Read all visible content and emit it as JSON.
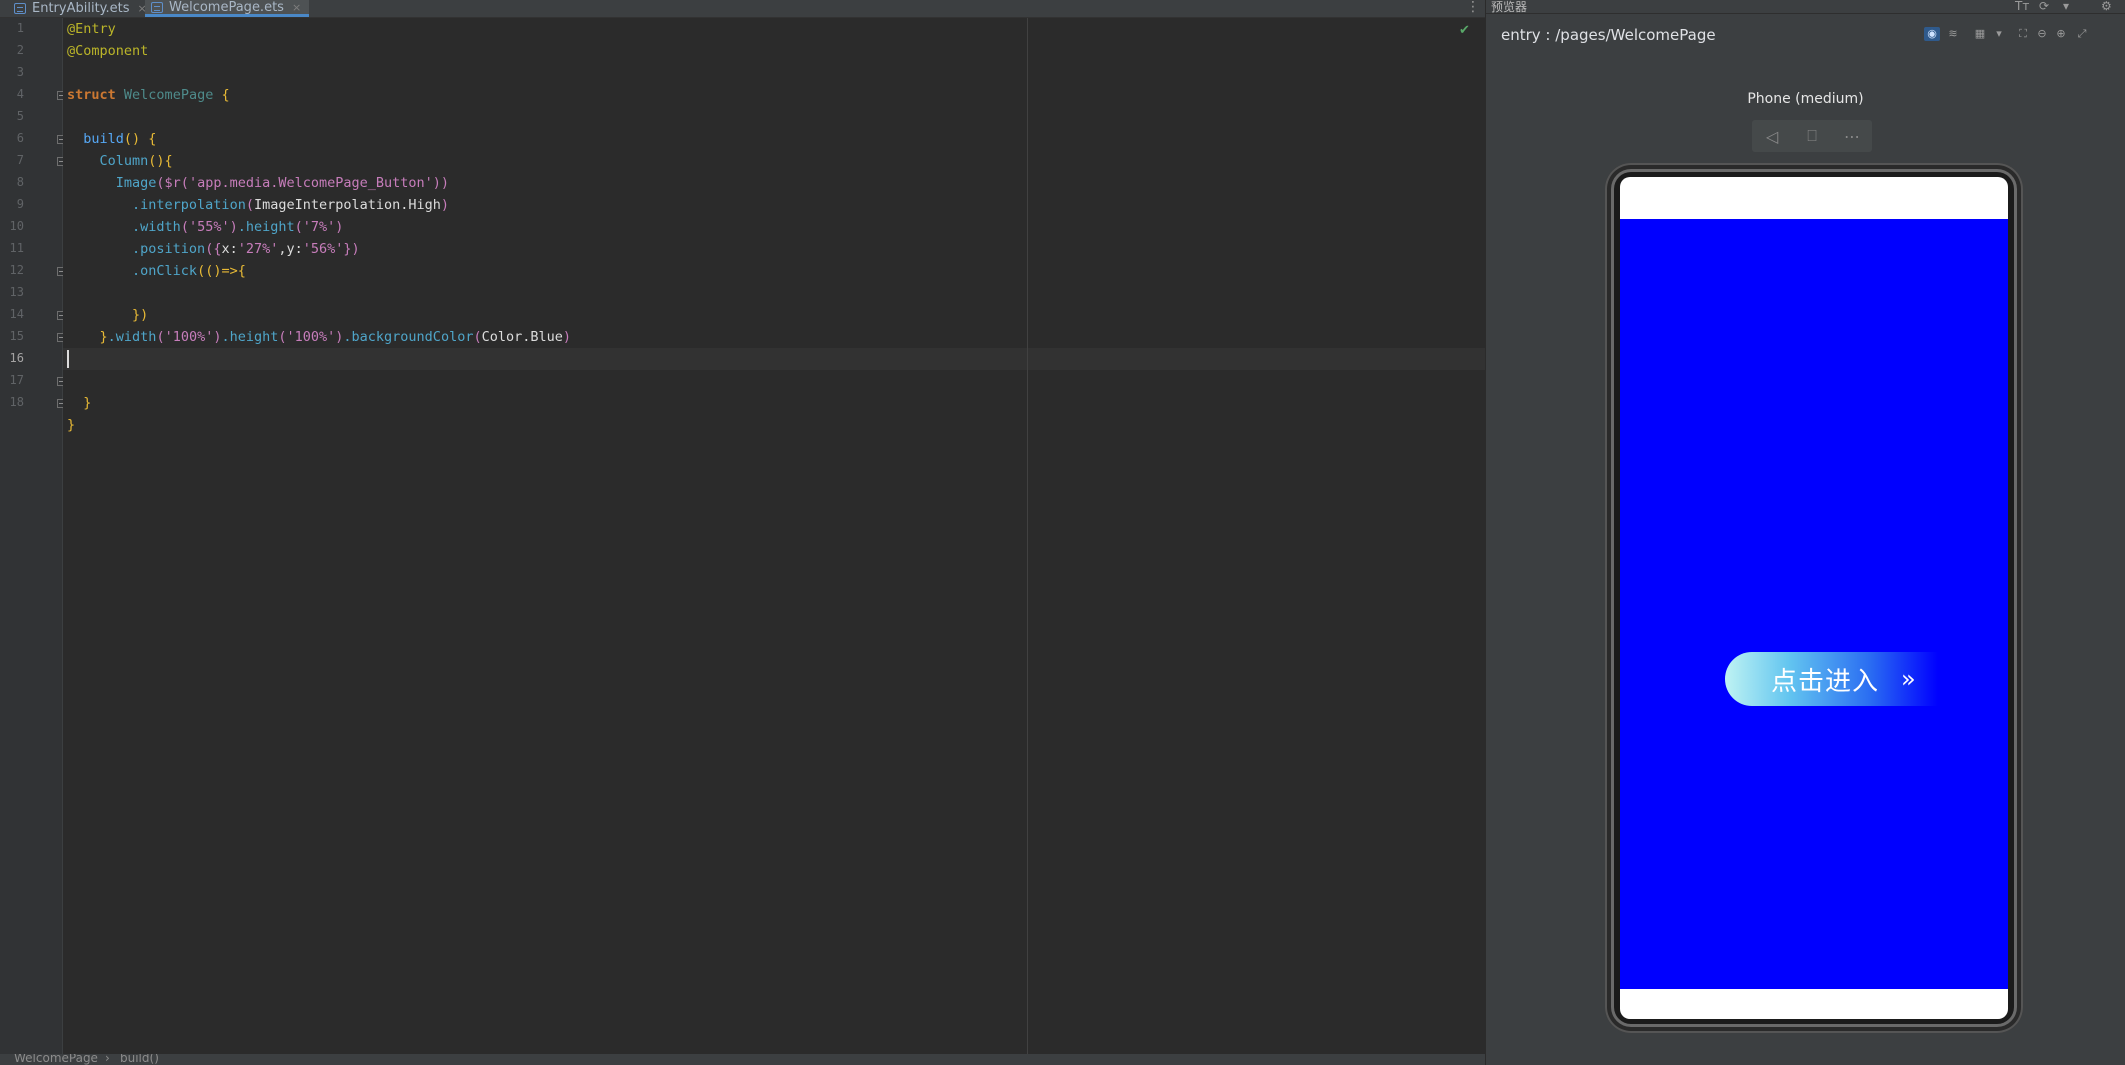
{
  "tabs": [
    {
      "label": "EntryAbility.ets",
      "close": "×",
      "active": false
    },
    {
      "label": "WelcomePage.ets",
      "close": "×",
      "active": true
    }
  ],
  "editor": {
    "line_numbers": [
      "1",
      "2",
      "3",
      "4",
      "5",
      "6",
      "7",
      "8",
      "9",
      "10",
      "11",
      "12",
      "13",
      "14",
      "15",
      "16",
      "17",
      "18"
    ],
    "current_line": "16",
    "code": {
      "l1": "@Entry",
      "l2": "@Component",
      "l4_kw": "struct",
      "l4_name": "WelcomePage",
      "l4_brace": "{",
      "l6_fn": "build",
      "l6_rest": "() {",
      "l7_fn": "Column",
      "l7_rest": "(){",
      "l8_fn": "Image",
      "l8_a": "($r(",
      "l8_str": "'app.media.WelcomePage_Button'",
      "l8_b": "))",
      "l9_fn": ".interpolation",
      "l9_a": "(",
      "l9_arg": "ImageInterpolation.High",
      "l9_b": ")",
      "l10_fn1": ".width",
      "l10_str1": "('55%')",
      "l10_fn2": ".height",
      "l10_str2": "('7%')",
      "l11_fn": ".position",
      "l11_a": "({",
      "l11_x": "x:",
      "l11_xv": "'27%'",
      "l11_sep": ",",
      "l11_y": "y:",
      "l11_yv": "'56%'",
      "l11_b": "})",
      "l12_fn": ".onClick",
      "l12_rest": "(()=>{",
      "l14": "})",
      "l15_a": "}",
      "l15_fn1": ".width",
      "l15_s1": "('100%')",
      "l15_fn2": ".height",
      "l15_s2": "('100%')",
      "l15_fn3": ".backgroundColor",
      "l15_c1": "(",
      "l15_arg": "Color.Blue",
      "l15_c2": ")",
      "l17": "}",
      "l18": "}"
    }
  },
  "statusbar": {
    "breadcrumb_1": "WelcomePage",
    "sep": "›",
    "breadcrumb_2": "build()"
  },
  "preview": {
    "panel_title": "预览器",
    "path": "entry : /pages/WelcomePage",
    "device_name": "Phone (medium)",
    "device_tools": [
      "back-icon",
      "rotate-icon",
      "more-icon"
    ],
    "enter_button_label": "点击进入",
    "enter_button_arrow": "»",
    "page_background": "#0000ff"
  }
}
